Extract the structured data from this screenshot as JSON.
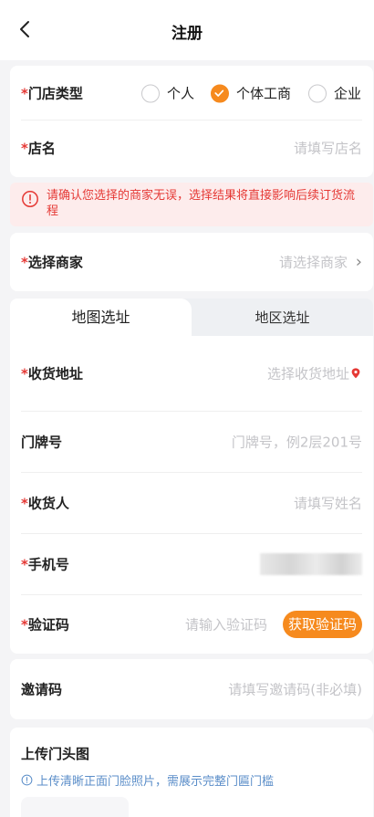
{
  "nav": {
    "title": "注册",
    "back_icon": "chevron-left-icon"
  },
  "store_type": {
    "label": "门店类型",
    "required_mark": "*",
    "options": [
      {
        "label": "个人",
        "selected": false
      },
      {
        "label": "个体工商",
        "selected": true
      },
      {
        "label": "企业",
        "selected": false
      }
    ]
  },
  "store_name": {
    "label": "店名",
    "required_mark": "*",
    "placeholder": "请填写店名"
  },
  "warning": {
    "icon": "info-circle-icon",
    "text": "请确认您选择的商家无误，选择结果将直接影响后续订货流程"
  },
  "merchant": {
    "label": "选择商家",
    "required_mark": "*",
    "placeholder": "请选择商家",
    "arrow": "›"
  },
  "tabs": [
    {
      "label": "地图选址",
      "active": true
    },
    {
      "label": "地区选址",
      "active": false
    }
  ],
  "address": {
    "label": "收货地址",
    "required_mark": "*",
    "placeholder": "选择收货地址",
    "icon": "location-pin-icon"
  },
  "door_number": {
    "label": "门牌号",
    "placeholder": "门牌号，例2层201号"
  },
  "receiver": {
    "label": "收货人",
    "required_mark": "*",
    "placeholder": "请填写姓名"
  },
  "phone": {
    "label": "手机号",
    "required_mark": "*"
  },
  "verify_code": {
    "label": "验证码",
    "required_mark": "*",
    "placeholder": "请输入验证码",
    "button": "获取验证码"
  },
  "invite_code": {
    "label": "邀请码",
    "placeholder": "请填写邀请码(非必填)"
  },
  "upload": {
    "title": "上传门头图",
    "tip": "上传清晰正面门脸照片，需展示完整门匾门槛"
  },
  "colors": {
    "accent": "#f68a1e",
    "warning_text": "#e53935",
    "warning_bg": "#fdecec",
    "tip_text": "#5b8ec9"
  }
}
